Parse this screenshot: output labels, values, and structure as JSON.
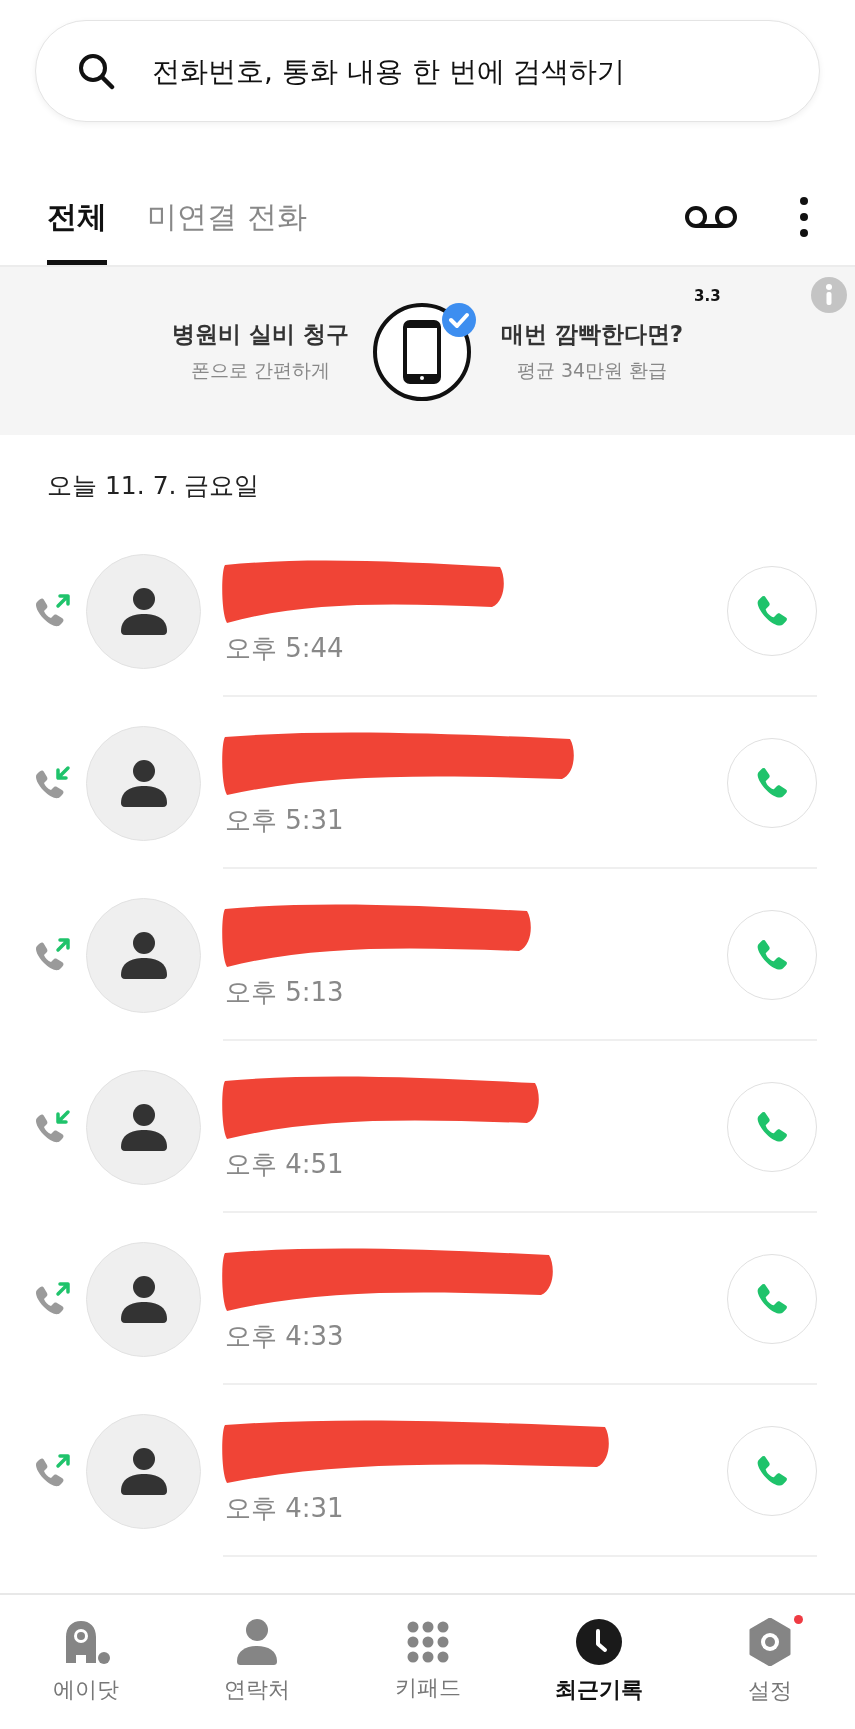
{
  "search": {
    "placeholder": "전화번호, 통화 내용 한 번에 검색하기"
  },
  "tabs": [
    {
      "label": "전체",
      "selected": true
    },
    {
      "label": "미연결 전화",
      "selected": false
    }
  ],
  "banner": {
    "left_title": "병원비 실비 청구",
    "left_subtitle": "폰으로 간편하게",
    "right_title": "매번 깜빡한다면?",
    "right_subtitle": "평균 34만원 환급",
    "tag": "3.3"
  },
  "date_header": "오늘 11. 7. 금요일",
  "calls": [
    {
      "kind": "outgoing",
      "name_redacted": true,
      "time": "오후 5:44"
    },
    {
      "kind": "incoming",
      "name_redacted": true,
      "time": "오후 5:31"
    },
    {
      "kind": "outgoing",
      "name_redacted": true,
      "time": "오후 5:13"
    },
    {
      "kind": "incoming",
      "name_redacted": true,
      "time": "오후 4:51"
    },
    {
      "kind": "outgoing",
      "name_redacted": true,
      "time": "오후 4:33"
    },
    {
      "kind": "outgoing",
      "name_redacted": true,
      "time": "오후 4:31"
    }
  ],
  "bottom_nav": [
    {
      "label": "에이닷",
      "selected": false,
      "notification_dot": false
    },
    {
      "label": "연락처",
      "selected": false,
      "notification_dot": false
    },
    {
      "label": "키패드",
      "selected": false,
      "notification_dot": false
    },
    {
      "label": "최근기록",
      "selected": true,
      "notification_dot": false
    },
    {
      "label": "설정",
      "selected": false,
      "notification_dot": true
    }
  ]
}
